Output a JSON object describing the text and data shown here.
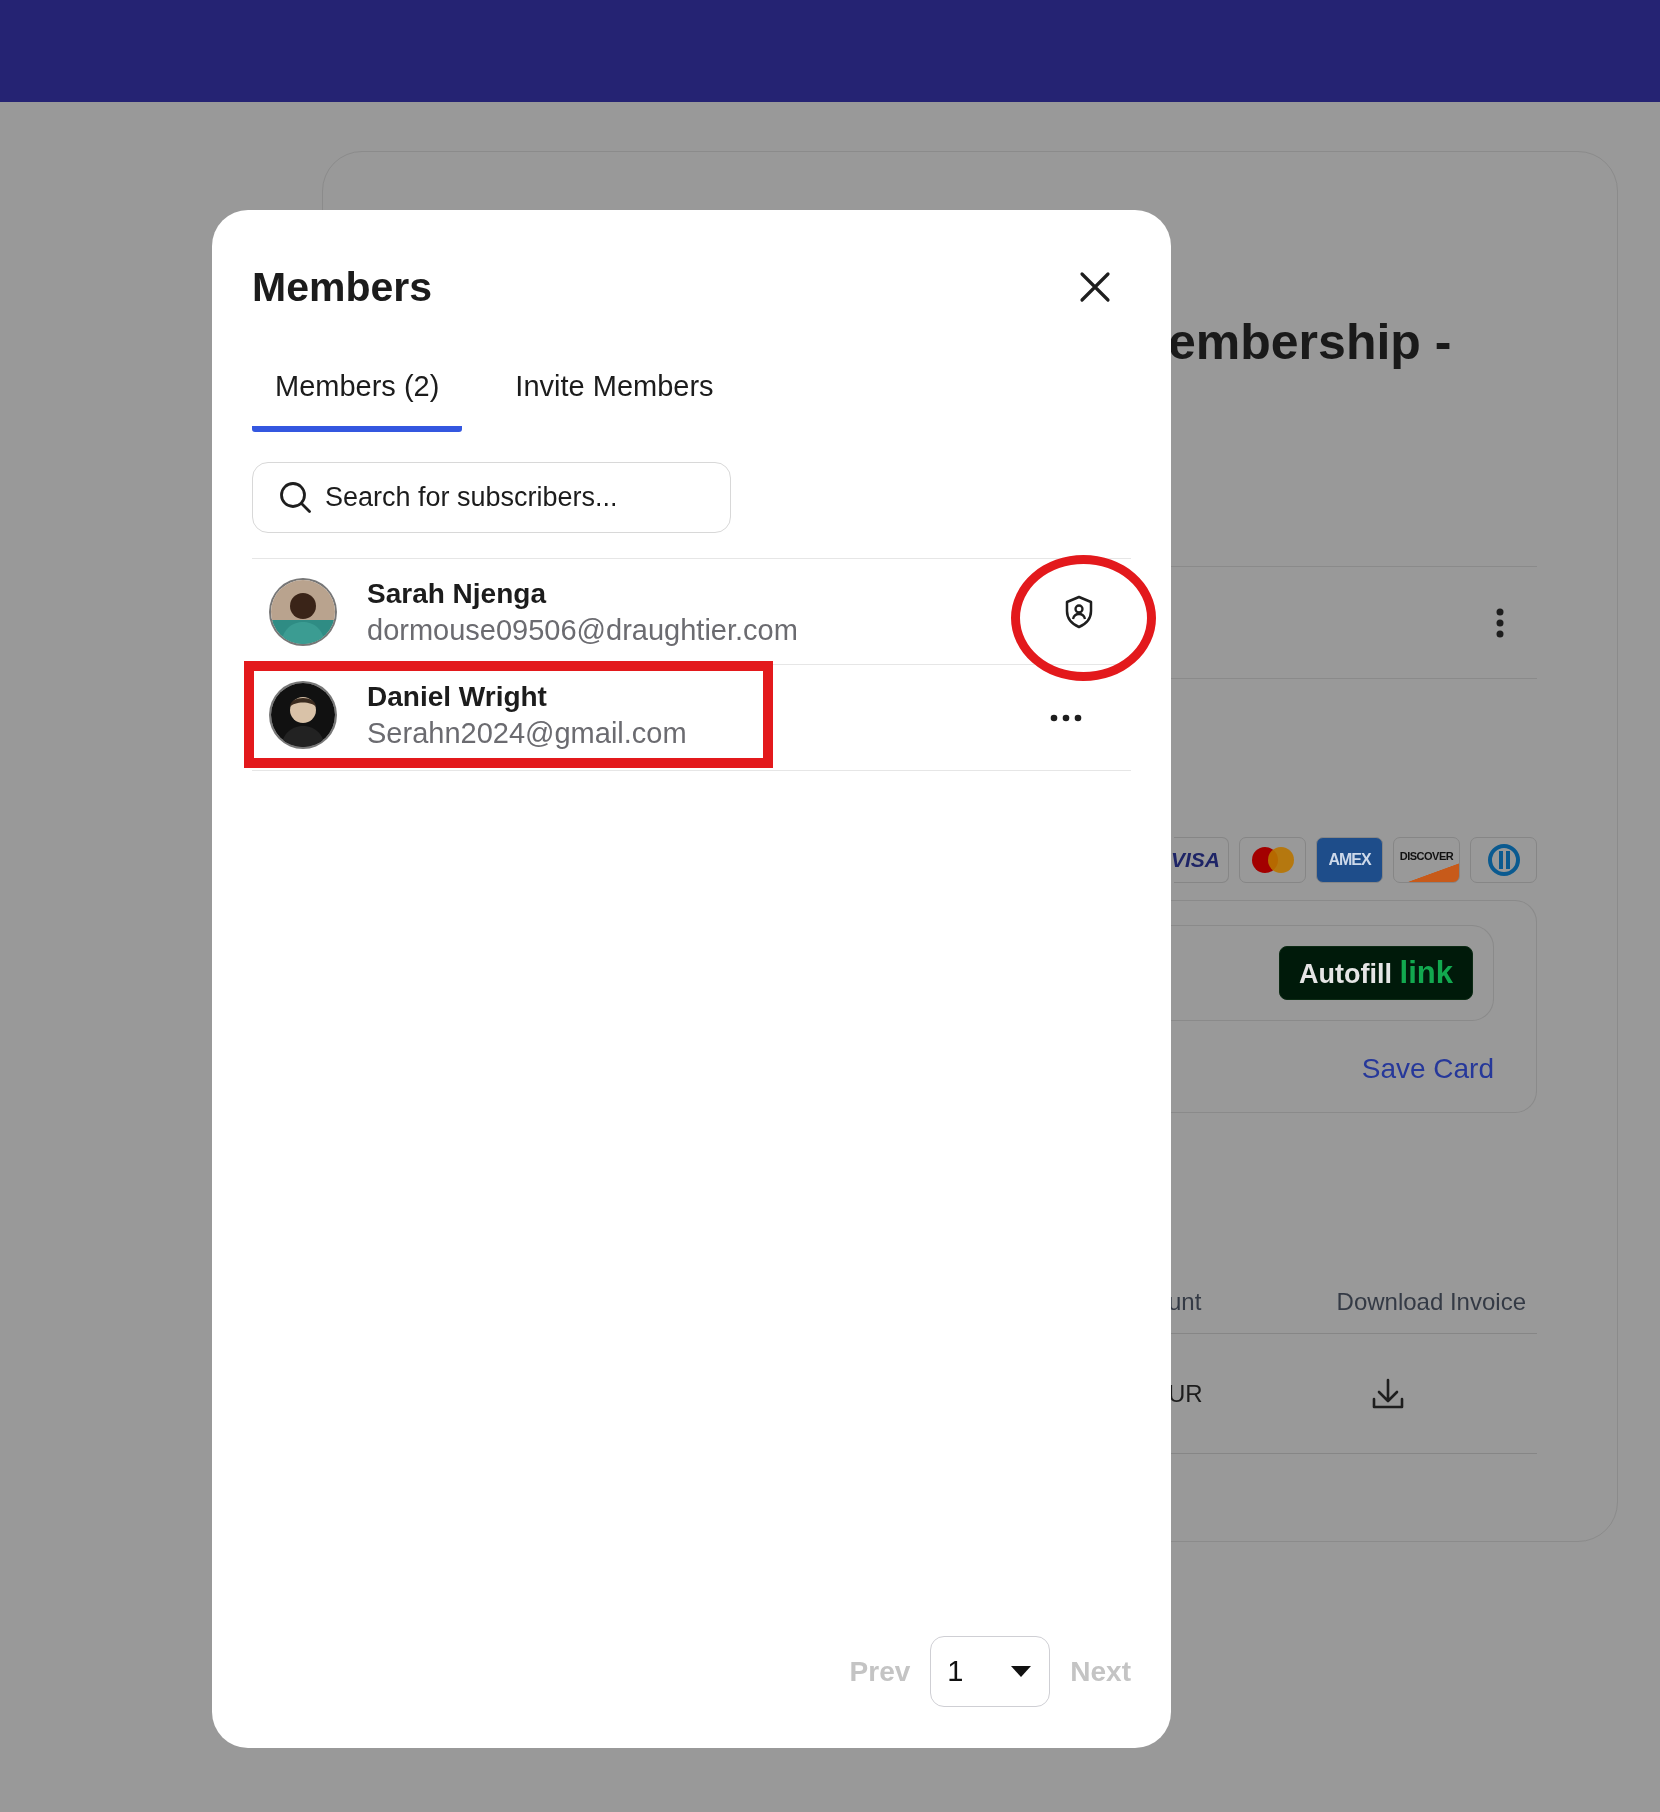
{
  "background_page": {
    "heading": "embership -",
    "payment_methods": [
      {
        "kind": "visa",
        "label": "VISA"
      },
      {
        "kind": "mastercard"
      },
      {
        "kind": "amex",
        "label": "AMEX"
      },
      {
        "kind": "discover",
        "label": "DISCOVER"
      },
      {
        "kind": "diners"
      }
    ],
    "autofill_button": {
      "label": "Autofill",
      "brand": "link"
    },
    "save_card_link": "Save Card",
    "invoices": {
      "columns": [
        "unt",
        "Download Invoice"
      ],
      "rows": [
        {
          "column_1": "UR"
        }
      ]
    }
  },
  "modal": {
    "title": "Members",
    "tabs": [
      {
        "label": "Members (2)",
        "selected": true
      },
      {
        "label": "Invite Members",
        "selected": false
      }
    ],
    "search": {
      "placeholder": "Search for subscribers..."
    },
    "members": [
      {
        "name": "Sarah Njenga",
        "email": "dormouse09506@draughtier.com",
        "kind": "shield",
        "action_circled": true,
        "identity_boxed": false
      },
      {
        "name": "Daniel Wright",
        "email": "Serahn2024@gmail.com",
        "kind": "more",
        "action_circled": false,
        "identity_boxed": true
      }
    ],
    "pagination": {
      "prev": {
        "label": "Prev",
        "disabled": true
      },
      "page": "1",
      "next": {
        "label": "Next",
        "disabled": true
      }
    }
  }
}
